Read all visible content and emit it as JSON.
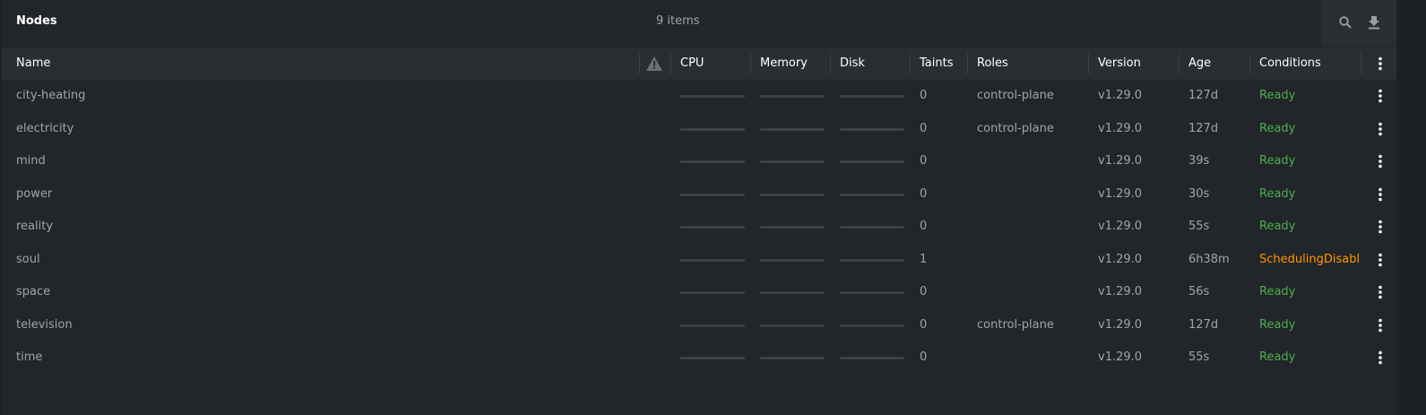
{
  "header": {
    "title": "Nodes",
    "count": "9 items",
    "search_icon": "search-icon",
    "download_icon": "download-icon"
  },
  "columns": {
    "name": "Name",
    "warning_icon": "warning-icon",
    "cpu": "CPU",
    "memory": "Memory",
    "disk": "Disk",
    "taints": "Taints",
    "roles": "Roles",
    "version": "Version",
    "age": "Age",
    "conditions": "Conditions",
    "menu_icon": "more-vertical-icon"
  },
  "colors": {
    "ready": "#4caf50",
    "warning": "#ff9800",
    "background": "#222529",
    "header": "#2a2e33"
  },
  "rows": [
    {
      "name": "city-heating",
      "taints": "0",
      "roles": "control-plane",
      "version": "v1.29.0",
      "age": "127d",
      "condition": "Ready",
      "status": "ready"
    },
    {
      "name": "electricity",
      "taints": "0",
      "roles": "control-plane",
      "version": "v1.29.0",
      "age": "127d",
      "condition": "Ready",
      "status": "ready"
    },
    {
      "name": "mind",
      "taints": "0",
      "roles": "",
      "version": "v1.29.0",
      "age": "39s",
      "condition": "Ready",
      "status": "ready"
    },
    {
      "name": "power",
      "taints": "0",
      "roles": "",
      "version": "v1.29.0",
      "age": "30s",
      "condition": "Ready",
      "status": "ready"
    },
    {
      "name": "reality",
      "taints": "0",
      "roles": "",
      "version": "v1.29.0",
      "age": "55s",
      "condition": "Ready",
      "status": "ready"
    },
    {
      "name": "soul",
      "taints": "1",
      "roles": "",
      "version": "v1.29.0",
      "age": "6h38m",
      "condition": "SchedulingDisabled",
      "status": "warning"
    },
    {
      "name": "space",
      "taints": "0",
      "roles": "",
      "version": "v1.29.0",
      "age": "56s",
      "condition": "Ready",
      "status": "ready"
    },
    {
      "name": "television",
      "taints": "0",
      "roles": "control-plane",
      "version": "v1.29.0",
      "age": "127d",
      "condition": "Ready",
      "status": "ready"
    },
    {
      "name": "time",
      "taints": "0",
      "roles": "",
      "version": "v1.29.0",
      "age": "55s",
      "condition": "Ready",
      "status": "ready"
    }
  ]
}
